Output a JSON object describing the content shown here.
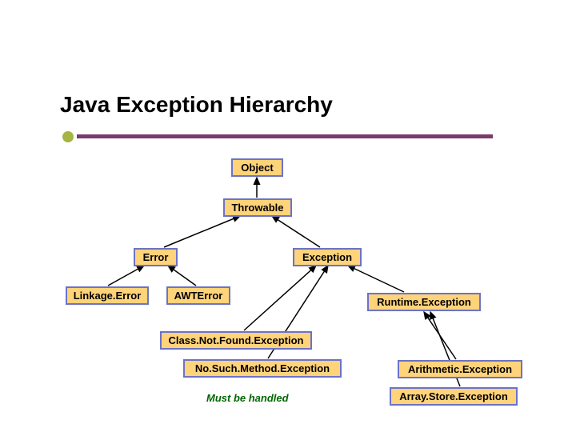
{
  "title": "Java Exception Hierarchy",
  "nodes": {
    "object": "Object",
    "throwable": "Throwable",
    "error": "Error",
    "exception": "Exception",
    "linkage_error": "Linkage.Error",
    "awt_error": "AWTError",
    "runtime_exception": "Runtime.Exception",
    "class_not_found": "Class.Not.Found.Exception",
    "no_such_method": "No.Such.Method.Exception",
    "arithmetic_exception": "Arithmetic.Exception",
    "array_store_exception": "Array.Store.Exception"
  },
  "caption": "Must be handled"
}
